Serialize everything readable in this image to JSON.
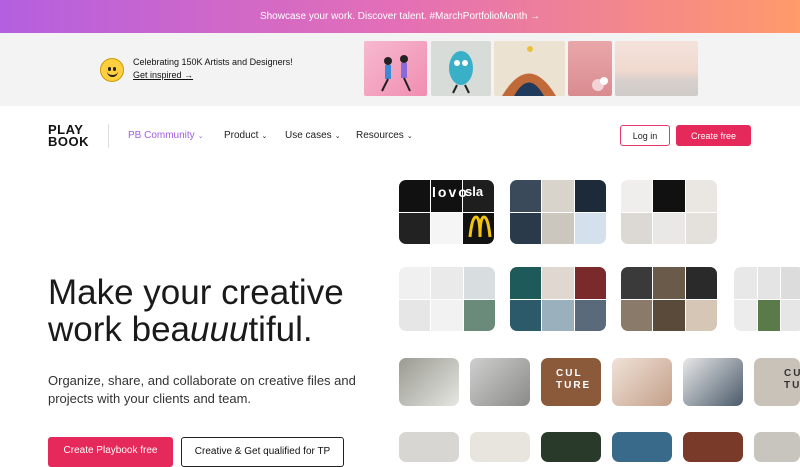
{
  "announcement": {
    "text": "Showcase your work. Discover talent. #MarchPortfolioMonth →"
  },
  "banner": {
    "title": "Celebrating 150K Artists and Designers!",
    "link": "Get inspired →",
    "thumbs": [
      {
        "color": "#f2a6c0"
      },
      {
        "color": "#d6dcd6"
      },
      {
        "color": "#e9dfcf"
      },
      {
        "color": "#e4aeb0"
      },
      {
        "color": "#f1dcd3"
      }
    ]
  },
  "nav": {
    "logo_line1": "PLAY",
    "logo_line2": "BOOK",
    "items": [
      {
        "label": "PB Community",
        "chev": "⌄"
      },
      {
        "label": "Product",
        "chev": "⌄"
      },
      {
        "label": "Use cases",
        "chev": "⌄"
      },
      {
        "label": "Resources",
        "chev": "⌄"
      }
    ],
    "login": "Log in",
    "create": "Create free"
  },
  "hero": {
    "line1": "Make your creative",
    "line2_pre": "work bea",
    "line2_ital": "uuu",
    "line2_post": "tiful.",
    "sub": "Organize, share, and collaborate on creative files and projects with your clients and team.",
    "cta_primary": "Create Playbook free",
    "cta_secondary": "Creative & Get qualified for TP"
  },
  "gallery": {
    "tile_texts": [
      "lovo",
      "sla",
      "CUL TURE",
      "CUL TURE"
    ]
  }
}
